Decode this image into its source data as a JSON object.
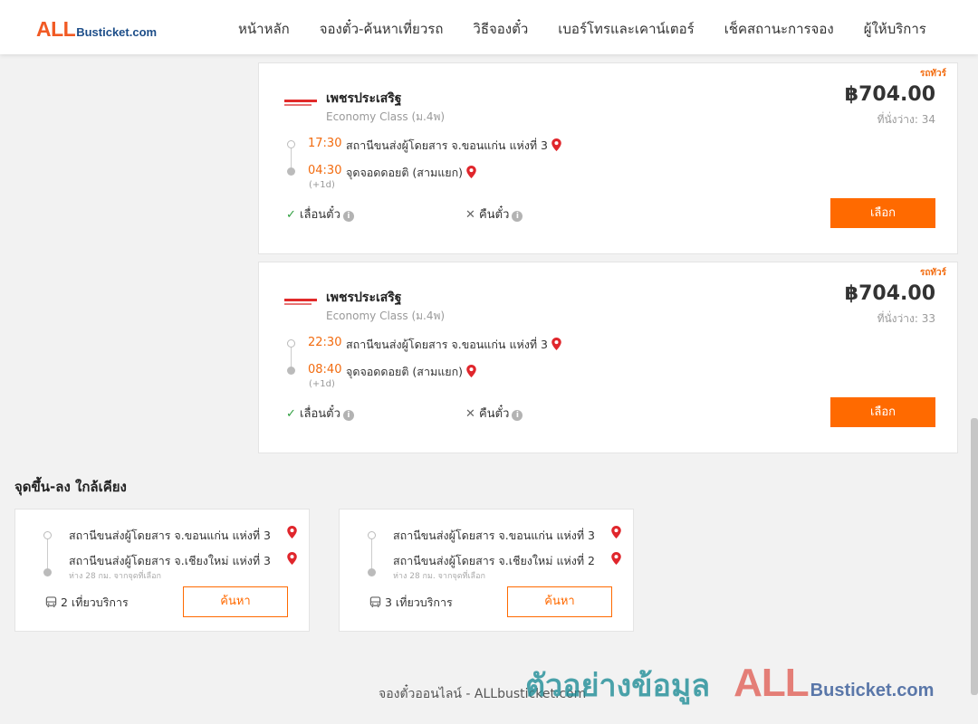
{
  "header": {
    "logo_all": "ALL",
    "logo_rest": "Busticket.com",
    "nav": [
      "หน้าหลัก",
      "จองตั๋ว-ค้นหาเที่ยวรถ",
      "วิธีจองตั๋ว",
      "เบอร์โทรและเคาน์เตอร์",
      "เช็คสถานะการจอง",
      "ผู้ให้บริการ"
    ]
  },
  "trips": [
    {
      "badge": "รถทัวร์",
      "operator": "เพชรประเสริฐ",
      "bus_class": "Economy Class (ม.4พ)",
      "price": "฿704.00",
      "seats": "ที่นั่งว่าง: 34",
      "dep_time": "17:30",
      "dep_place": "สถานีขนส่งผู้โดยสาร จ.ขอนแก่น แห่งที่ 3",
      "arr_time": "04:30",
      "arr_place": "จุดจอดดอยติ (สามแยก)",
      "plus_day": "(+1d)",
      "feature_reschedule": "เลื่อนตั๋ว",
      "feature_refund": "คืนตั๋ว",
      "select_label": "เลือก"
    },
    {
      "badge": "รถทัวร์",
      "operator": "เพชรประเสริฐ",
      "bus_class": "Economy Class (ม.4พ)",
      "price": "฿704.00",
      "seats": "ที่นั่งว่าง: 33",
      "dep_time": "22:30",
      "dep_place": "สถานีขนส่งผู้โดยสาร จ.ขอนแก่น แห่งที่ 3",
      "arr_time": "08:40",
      "arr_place": "จุดจอดดอยติ (สามแยก)",
      "plus_day": "(+1d)",
      "feature_reschedule": "เลื่อนตั๋ว",
      "feature_refund": "คืนตั๋ว",
      "select_label": "เลือก"
    }
  ],
  "nearby": {
    "title": "จุดขึ้น-ลง ใกล้เคียง",
    "cards": [
      {
        "from": "สถานีขนส่งผู้โดยสาร จ.ขอนแก่น แห่งที่ 3",
        "to": "สถานีขนส่งผู้โดยสาร จ.เชียงใหม่ แห่งที่ 3",
        "distance": "ห่าง 28 กม. จากจุดที่เลือก",
        "trips": "2 เที่ยวบริการ",
        "search_label": "ค้นหา"
      },
      {
        "from": "สถานีขนส่งผู้โดยสาร จ.ขอนแก่น แห่งที่ 3",
        "to": "สถานีขนส่งผู้โดยสาร จ.เชียงใหม่ แห่งที่ 2",
        "distance": "ห่าง 28 กม. จากจุดที่เลือก",
        "trips": "3 เที่ยวบริการ",
        "search_label": "ค้นหา"
      }
    ]
  },
  "footer": {
    "text": "จองตั๋วออนไลน์ - ALLbusticket.com"
  },
  "watermark": {
    "thai": "ตัวอย่างข้อมูล",
    "all": "ALL",
    "rest": "Busticket.com"
  },
  "colors": {
    "accent": "#ff6a00",
    "time": "#f26b0f",
    "check": "#2e9e3e",
    "pin": "#e0262c"
  },
  "icons": {
    "pin": "map-pin-icon",
    "check": "check-icon",
    "cross": "cross-icon",
    "info": "info-icon",
    "bus": "bus-icon"
  }
}
